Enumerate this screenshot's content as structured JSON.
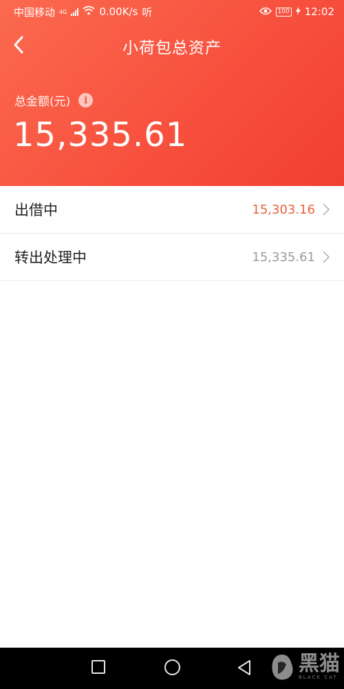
{
  "status_bar": {
    "carrier": "中国移动",
    "network": "4G",
    "speed": "0.00K/s",
    "extra": "听",
    "battery": "100",
    "time": "12:02",
    "icons": [
      "signal-icon",
      "wifi-icon",
      "eye-icon",
      "battery-icon",
      "charging-icon"
    ]
  },
  "header": {
    "title": "小荷包总资产",
    "back_icon": "chevron-left-icon",
    "total_label": "总金额(元)",
    "info_icon_glyph": "i",
    "total_amount": "15,335.61",
    "gradient_colors": [
      "#fb6a4f",
      "#f13f33"
    ]
  },
  "rows": [
    {
      "label": "出借中",
      "value": "15,303.16",
      "value_color": "#e8603c"
    },
    {
      "label": "转出处理中",
      "value": "15,335.61",
      "value_color": "#9a9a9a"
    }
  ],
  "system_nav": {
    "buttons": [
      "recent-apps-icon",
      "home-icon",
      "back-triangle-icon"
    ]
  },
  "watermark": {
    "text": "黑猫",
    "sub": "BLACK CAT"
  }
}
